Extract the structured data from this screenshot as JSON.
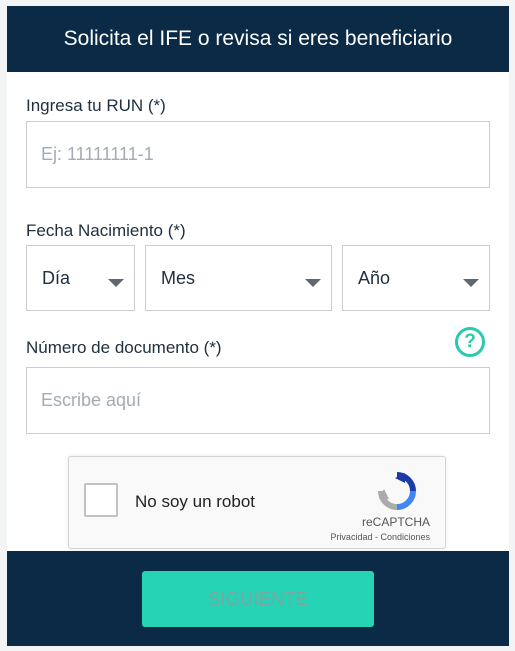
{
  "header": {
    "title": "Solicita el IFE o revisa si eres beneficiario"
  },
  "run": {
    "label": "Ingresa tu RUN (*)",
    "placeholder": "Ej: 11111111-1",
    "value": ""
  },
  "birthdate": {
    "label": "Fecha Nacimiento (*)",
    "day": "Día",
    "month": "Mes",
    "year": "Año"
  },
  "document": {
    "label": "Número de documento (*)",
    "placeholder": "Escribe aquí",
    "value": "",
    "help_glyph": "?",
    "help_icon": "question-circle-icon"
  },
  "captcha": {
    "label": "No soy un robot",
    "brand": "reCAPTCHA",
    "links": "Privacidad - Condiciones",
    "checked": false
  },
  "footer": {
    "submit_label": "SIGUIENTE"
  },
  "colors": {
    "header_bg": "#0a2a45",
    "accent": "#26d3b4",
    "help": "#2bc9ad"
  }
}
